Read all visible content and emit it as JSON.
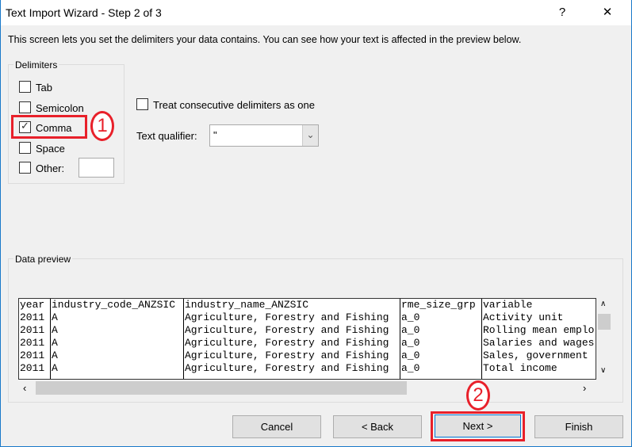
{
  "window": {
    "title": "Text Import Wizard - Step 2 of 3",
    "help": "?",
    "close": "✕"
  },
  "intro": "This screen lets you set the delimiters your data contains.  You can see how your text is affected in the preview below.",
  "delimiters": {
    "label": "Delimiters",
    "items": [
      {
        "label": "Tab",
        "checked": false
      },
      {
        "label": "Semicolon",
        "checked": false
      },
      {
        "label": "Comma",
        "checked": true
      },
      {
        "label": "Space",
        "checked": false
      },
      {
        "label": "Other:",
        "checked": false
      }
    ],
    "other_value": ""
  },
  "consecutive": {
    "label": "Treat consecutive delimiters as one",
    "checked": false
  },
  "qualifier": {
    "label": "Text qualifier:",
    "value": "\""
  },
  "annotations": {
    "one": "1",
    "two": "2",
    "color": "#e8202a"
  },
  "preview": {
    "label": "Data preview",
    "columns": [
      [
        "year",
        "2011",
        "2011",
        "2011",
        "2011",
        "2011"
      ],
      [
        "industry_code_ANZSIC",
        "A",
        "A",
        "A",
        "A",
        "A"
      ],
      [
        "industry_name_ANZSIC",
        "Agriculture, Forestry and Fishing",
        "Agriculture, Forestry and Fishing",
        "Agriculture, Forestry and Fishing",
        "Agriculture, Forestry and Fishing",
        "Agriculture, Forestry and Fishing"
      ],
      [
        "rme_size_grp",
        "a_0",
        "a_0",
        "a_0",
        "a_0",
        "a_0"
      ],
      [
        "variable",
        "Activity unit",
        "Rolling mean emplo",
        "Salaries and wages",
        "Sales, government",
        "Total income"
      ]
    ]
  },
  "buttons": {
    "cancel": "Cancel",
    "back": "< Back",
    "next": "Next >",
    "finish": "Finish"
  }
}
